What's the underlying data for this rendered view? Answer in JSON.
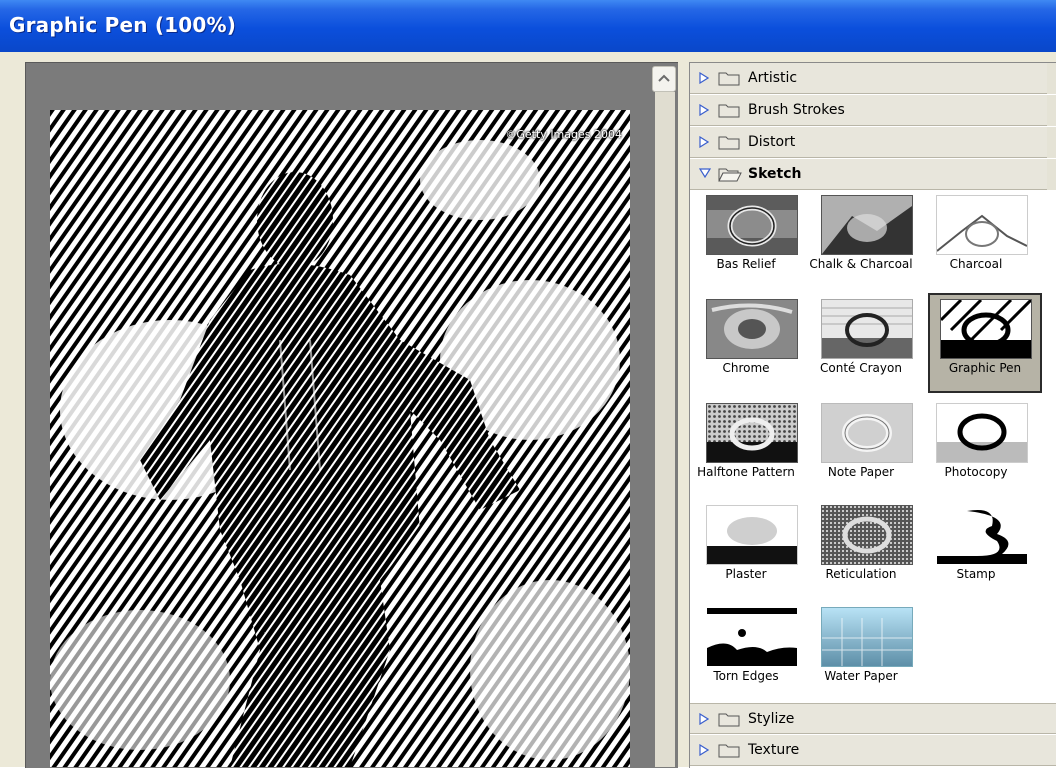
{
  "window": {
    "title": "Graphic Pen (100%)"
  },
  "preview": {
    "copyright": "©Getty Images 2004"
  },
  "filter_categories": {
    "top": [
      {
        "label": "Artistic",
        "icon": "folder-icon",
        "expanded": false
      },
      {
        "label": "Brush Strokes",
        "icon": "folder-icon",
        "expanded": false
      },
      {
        "label": "Distort",
        "icon": "folder-icon",
        "expanded": false
      },
      {
        "label": "Sketch",
        "icon": "folder-open-icon",
        "expanded": true
      }
    ],
    "bottom": [
      {
        "label": "Stylize",
        "icon": "folder-icon",
        "expanded": false
      },
      {
        "label": "Texture",
        "icon": "folder-icon",
        "expanded": false
      }
    ]
  },
  "sketch_filters": [
    {
      "label": "Bas Relief",
      "selected": false
    },
    {
      "label": "Chalk & Charcoal",
      "selected": false
    },
    {
      "label": "Charcoal",
      "selected": false
    },
    {
      "label": "Chrome",
      "selected": false
    },
    {
      "label": "Conté Crayon",
      "selected": false
    },
    {
      "label": "Graphic Pen",
      "selected": true
    },
    {
      "label": "Halftone Pattern",
      "selected": false
    },
    {
      "label": "Note Paper",
      "selected": false
    },
    {
      "label": "Photocopy",
      "selected": false
    },
    {
      "label": "Plaster",
      "selected": false
    },
    {
      "label": "Reticulation",
      "selected": false
    },
    {
      "label": "Stamp",
      "selected": false
    },
    {
      "label": "Torn Edges",
      "selected": false
    },
    {
      "label": "Water Paper",
      "selected": false
    }
  ],
  "colors": {
    "title_bar": "#0b4fdc",
    "selection": "#b6b3a6"
  }
}
